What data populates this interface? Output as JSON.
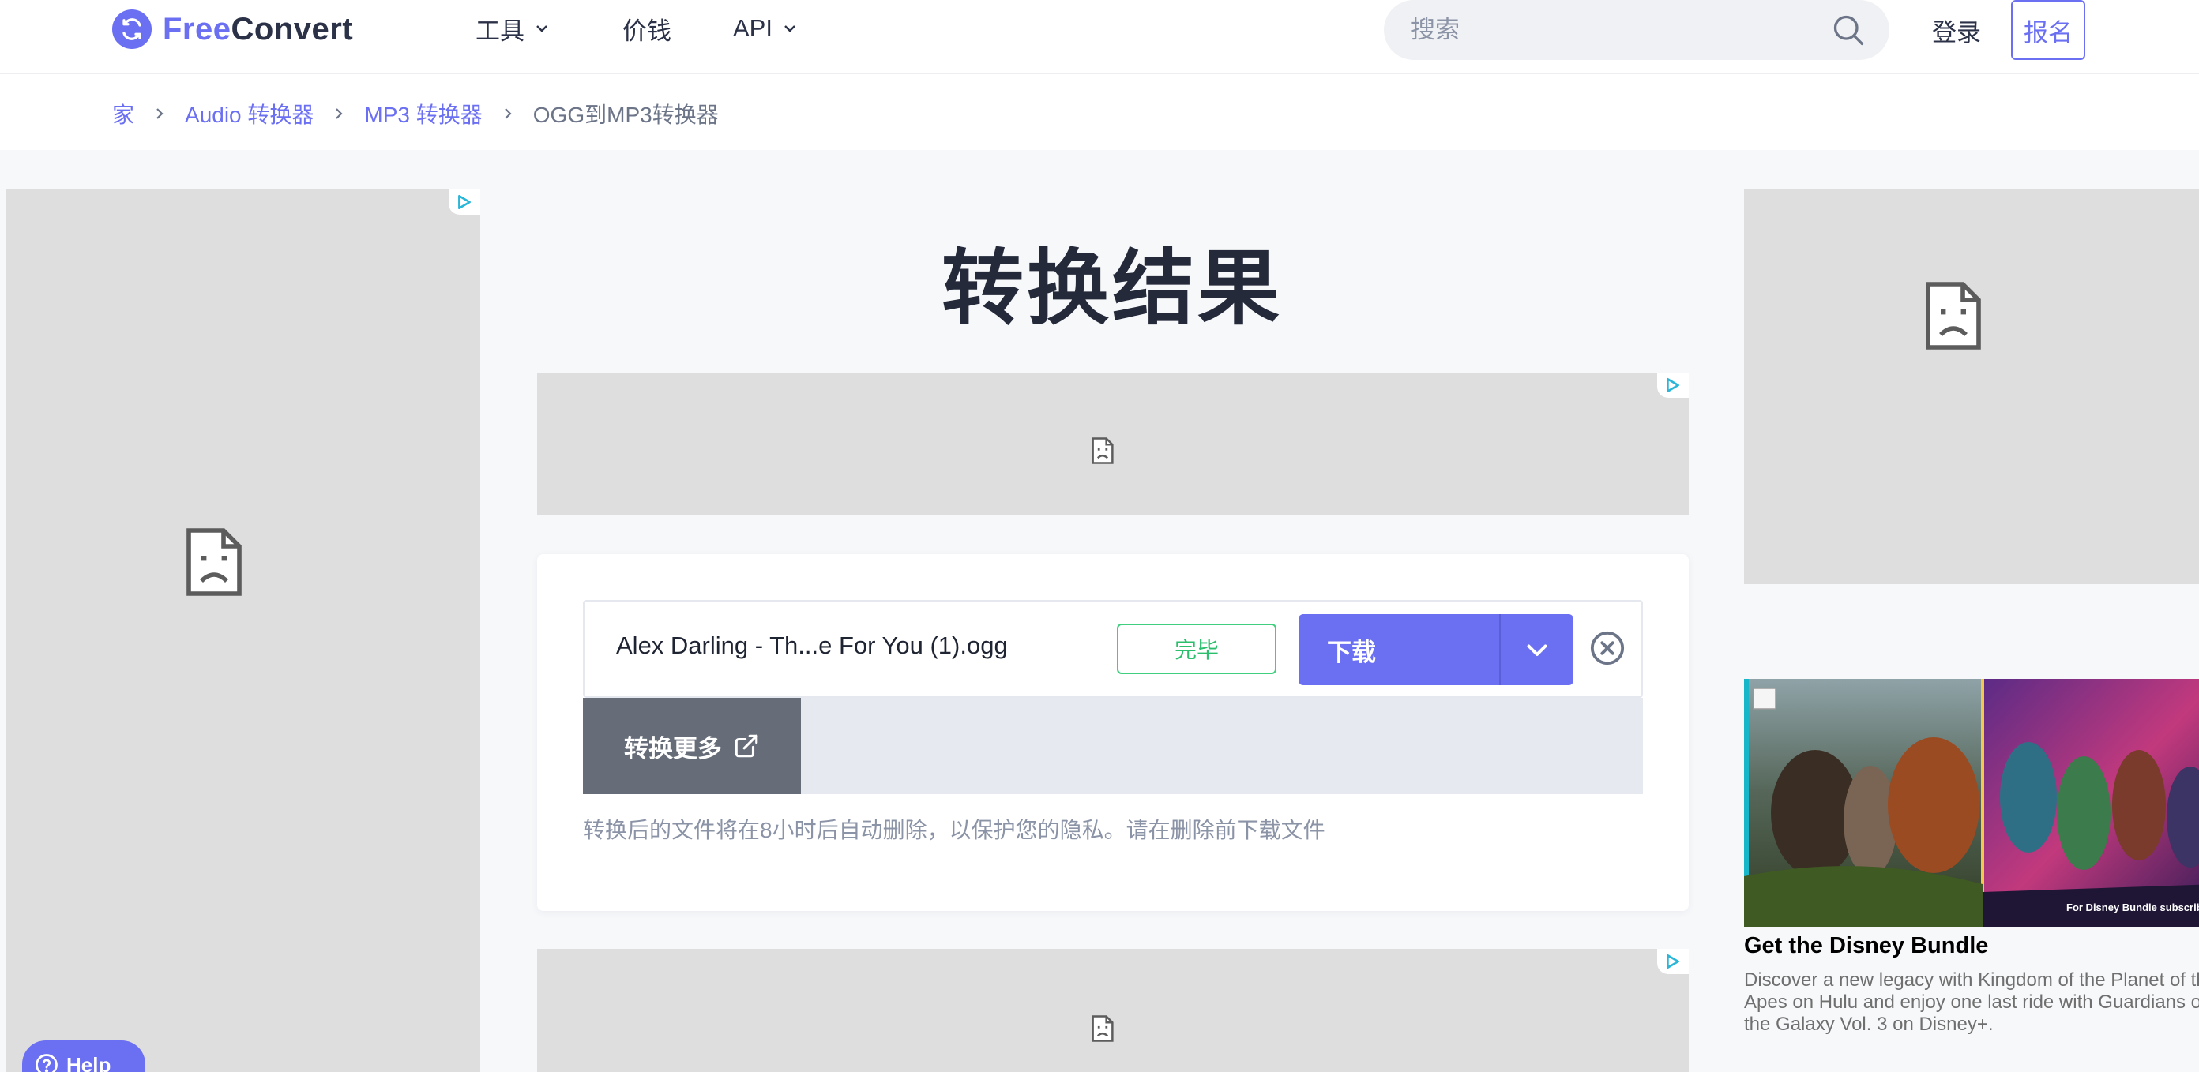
{
  "header": {
    "logo_free": "Free",
    "logo_convert": "Convert",
    "nav": {
      "tools": "工具",
      "pricing": "价钱",
      "api": "API"
    },
    "search_placeholder": "搜索",
    "login": "登录",
    "signup": "报名"
  },
  "breadcrumb": {
    "home": "家",
    "audio": "Audio 转换器",
    "mp3": "MP3 转换器",
    "current": "OGG到MP3转换器"
  },
  "main": {
    "title": "转换结果",
    "file": {
      "name": "Alex Darling - Th...e For You (1).ogg",
      "status": "完毕",
      "download_label": "下载"
    },
    "convert_more_label": "转换更多",
    "privacy_note": "转换后的文件将在8小时后自动删除，以保护您的隐私。请在删除前下载文件"
  },
  "promo": {
    "title": "Get the Disney Bundle",
    "desc_line1": "Discover a new legacy with Kingdom of the Planet of the",
    "desc_line2": "Apes on Hulu and enjoy one last ride with Guardians of",
    "desc_line3": "the Galaxy Vol. 3 on Disney+.",
    "image_caption": "For Disney Bundle subscribers"
  },
  "help": {
    "label": "Help"
  },
  "colors": {
    "brand": "#6b6ff2",
    "success": "#2bbf6d",
    "title": "#252a3a",
    "ad_placeholder": "#dedede"
  },
  "icons": [
    "logo-sync-icon",
    "chevron-down-icon",
    "search-icon",
    "chevron-right-icon",
    "adchoices-icon",
    "broken-image-icon",
    "close-circle-icon",
    "external-link-icon",
    "help-circle-icon"
  ]
}
